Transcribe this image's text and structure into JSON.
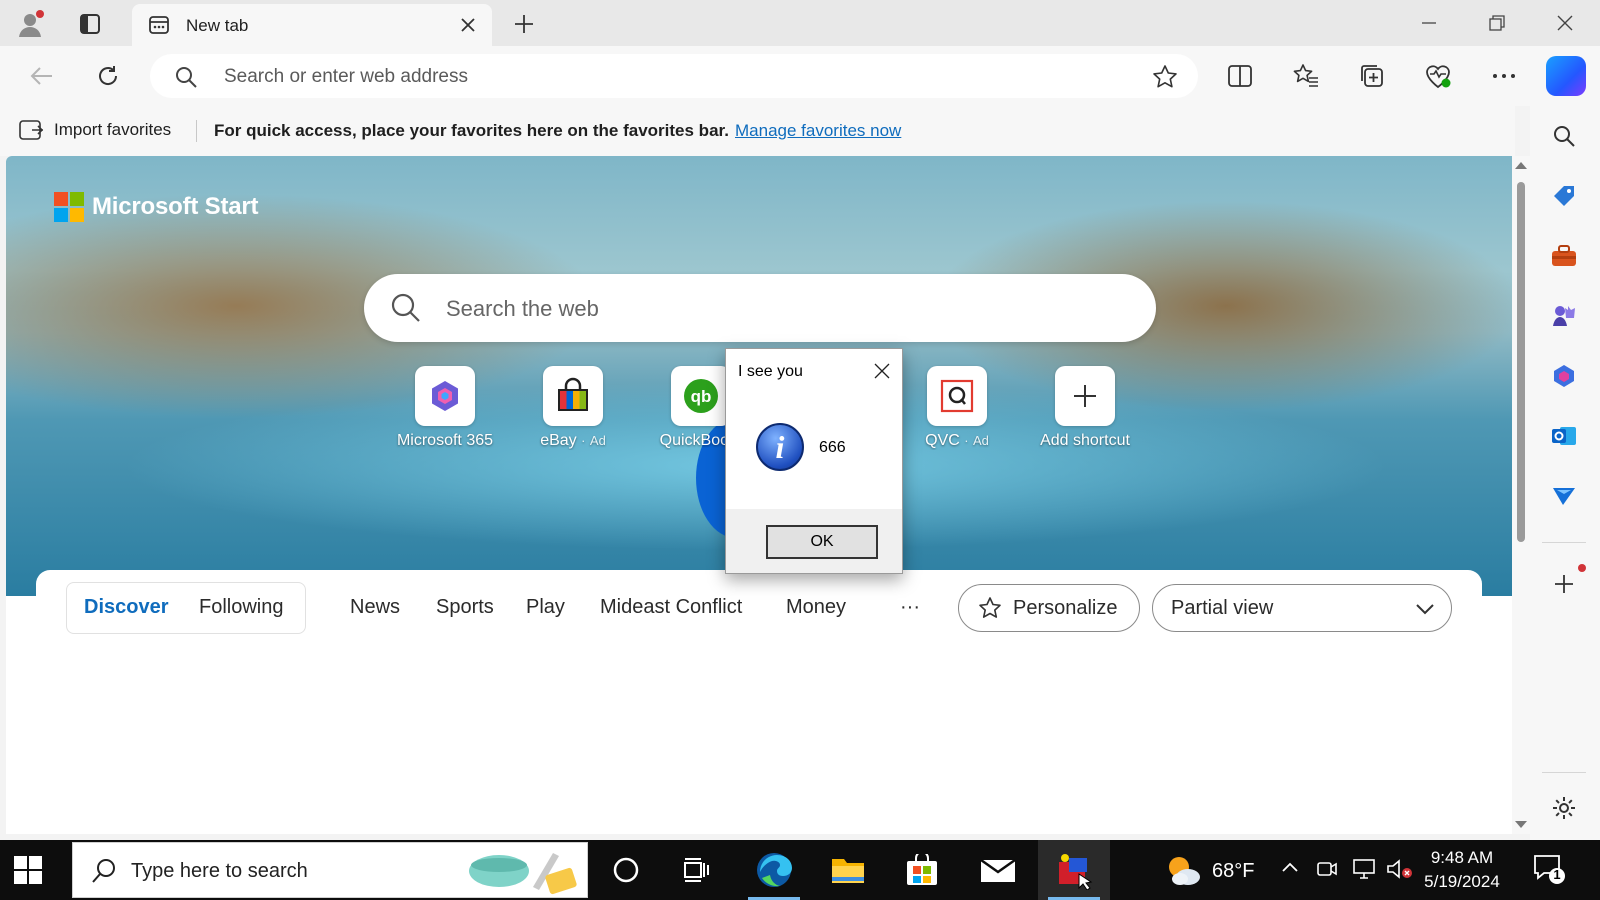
{
  "browser": {
    "tab": {
      "title": "New tab"
    },
    "address_bar": {
      "placeholder": "Search or enter web address"
    },
    "favorites_bar": {
      "import_label": "Import favorites",
      "message": "For quick access, place your favorites here on the favorites bar.",
      "link": "Manage favorites now"
    }
  },
  "page": {
    "brand": "Microsoft Start",
    "search_placeholder": "Search the web",
    "tiles": [
      {
        "label": "Microsoft 365",
        "ad": ""
      },
      {
        "label": "eBay",
        "ad": "Ad"
      },
      {
        "label": "QuickBoo...",
        "ad": ""
      },
      {
        "label": "QVC",
        "ad": "Ad"
      },
      {
        "label": "Add shortcut",
        "ad": ""
      }
    ],
    "feed_tabs": [
      "Discover",
      "Following",
      "News",
      "Sports",
      "Play",
      "Mideast Conflict",
      "Money",
      "···"
    ],
    "personalize_label": "Personalize",
    "view_select": {
      "value": "Partial view"
    }
  },
  "dialog": {
    "title": "I see you",
    "message": "666",
    "ok_label": "OK"
  },
  "taskbar": {
    "search_placeholder": "Type here to search",
    "weather": {
      "temp": "68°F"
    },
    "clock": {
      "time": "9:48 AM",
      "date": "5/19/2024"
    },
    "notification_count": "1"
  },
  "colors": {
    "accent": "#0f6cbd",
    "taskbar": "#0d0d0d",
    "dialog_icon": "#1f4fbf"
  },
  "icons": {
    "tabbar": [
      "profile-icon",
      "tab-actions-icon",
      "newtab-page-icon",
      "close-icon",
      "plus-icon",
      "minimize-icon",
      "restore-icon",
      "close-window-icon"
    ],
    "toolbar": [
      "back-icon",
      "refresh-icon",
      "search-icon",
      "favorite-star-icon",
      "split-screen-icon",
      "favorites-icon",
      "collections-icon",
      "browser-essentials-icon",
      "more-icon",
      "copilot-icon"
    ],
    "sidebar": [
      "search-icon",
      "shopping-tag-icon",
      "tools-icon",
      "games-icon",
      "m365-icon",
      "outlook-icon",
      "drop-icon",
      "add-icon",
      "settings-icon"
    ]
  }
}
